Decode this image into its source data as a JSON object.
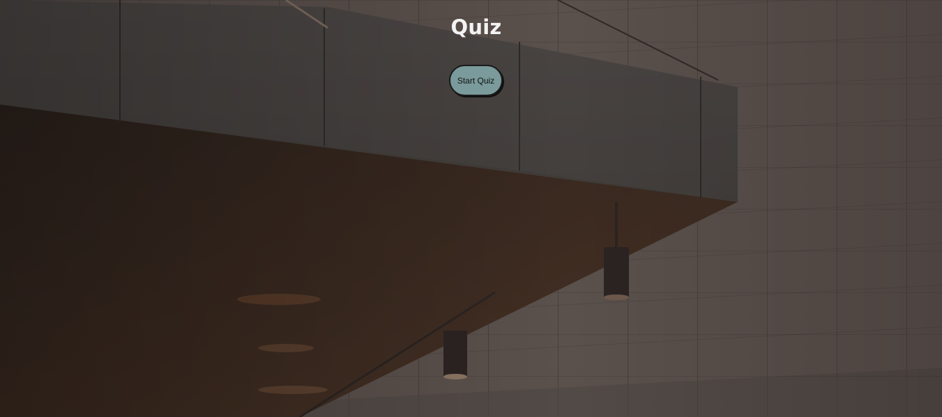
{
  "page": {
    "title": "Quiz",
    "start_button_label": "Start Quiz"
  },
  "colors": {
    "title_text": "#f3f3f3",
    "button_background": "#7a9a9b",
    "button_border": "#1a1a1a"
  }
}
